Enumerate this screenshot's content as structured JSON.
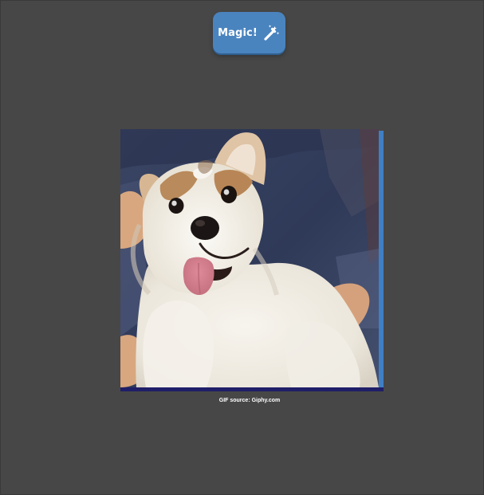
{
  "button": {
    "label": "Magic!",
    "icon": "magic-wand-icon",
    "color": "#4a84bf"
  },
  "image": {
    "alt": "",
    "caption": "GIF source: Giphy.com"
  },
  "colors": {
    "background": "#474747",
    "image_right_edge": "#3f7fc4",
    "image_bottom_edge": "#1f1e68"
  }
}
